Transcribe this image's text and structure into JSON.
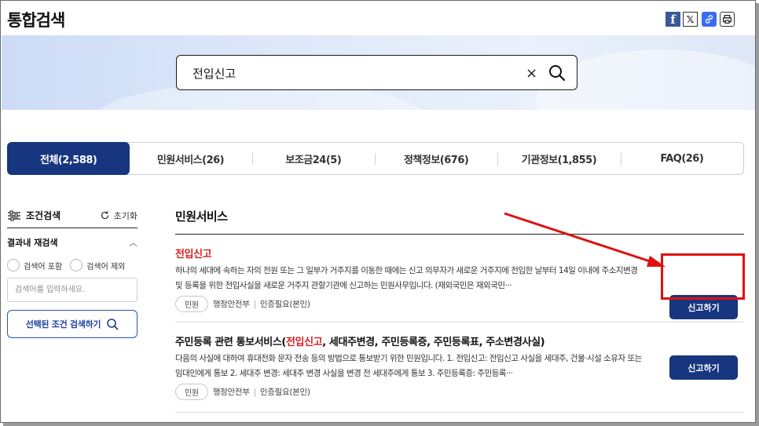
{
  "header": {
    "title": "통합검색",
    "share_icons": [
      "facebook-icon",
      "x-icon",
      "link-icon",
      "print-icon"
    ]
  },
  "search": {
    "value": "전입신고",
    "clear_label": "×"
  },
  "tabs": [
    {
      "label": "전체(2,588)",
      "active": true
    },
    {
      "label": "민원서비스(26)",
      "active": false
    },
    {
      "label": "보조금24(5)",
      "active": false
    },
    {
      "label": "정책정보(676)",
      "active": false
    },
    {
      "label": "기관정보(1,855)",
      "active": false
    },
    {
      "label": "FAQ(26)",
      "active": false
    }
  ],
  "sidebar": {
    "condition_label": "조건검색",
    "reset_label": "초기화",
    "refine_title": "결과내 재검색",
    "include_label": "검색어 포함",
    "exclude_label": "검색어 제외",
    "input_placeholder": "검색어를 입력하세요.",
    "apply_label": "선택된 조건 검색하기"
  },
  "main": {
    "section_title": "민원서비스",
    "results": [
      {
        "title": "전입신고",
        "description": "하나의 세대에 속하는 자의 전원 또는 그 일부가 거주지를 이동한 때에는 신고 의무자가 새로운 거주지에 전입한 날부터 14일 이내에 주소지변경 및 등록을 위한 전입사실을 새로운 거주지 관할기관에 신고하는 민원사무입니다. (재외국민은 재외국민···",
        "tag": "민원",
        "agency": "행정안전부",
        "auth": "인증필요(본인)",
        "button": "신고하기"
      },
      {
        "title_pre": "주민등록 관련 통보서비스(",
        "title_hl": "전입신고",
        "title_post": ", 세대주변경, 주민등록증, 주민등록표, 주소변경사실)",
        "description": "다음의 사실에 대하여 휴대전화 문자 전송 등의 방법으로 통보받기 위한 민원입니다. 1. 전입신고: 전입신고 사실을 세대주, 건물·시설 소유자 또는 임대인에게 통보 2. 세대주 변경: 세대주 변경 사실을 변경 전 세대주에게 통보 3. 주민등록증: 주민등록···",
        "tag": "민원",
        "agency": "행정안전부",
        "auth": "인증필요(본인)",
        "button": "신고하기"
      }
    ]
  },
  "colors": {
    "primary": "#17367f",
    "highlight": "#d81e1e",
    "annotation": "#e01010"
  }
}
